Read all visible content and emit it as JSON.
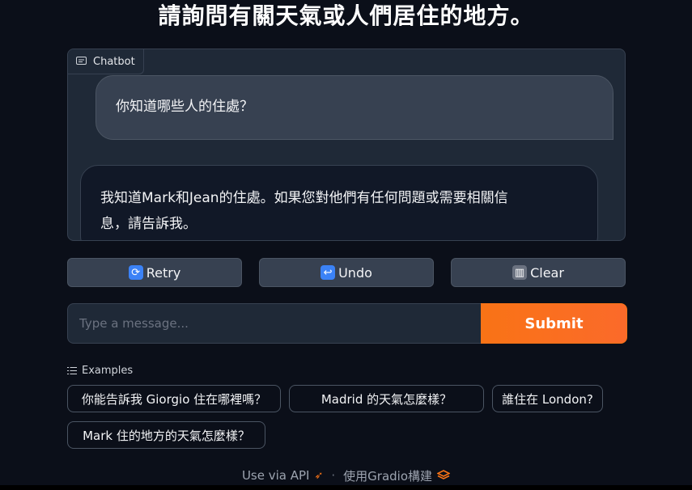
{
  "title": "請詢問有關天氣或人們居住的地方。",
  "chatbot": {
    "label": "Chatbot",
    "messages": [
      {
        "role": "user",
        "text": "你知道哪些人的住處？"
      },
      {
        "role": "bot",
        "line1": "我知道Mark和Jean的住處。如果您對他們有任何問題或需要相關信",
        "line2": "息，請告訴我。"
      }
    ]
  },
  "buttons": {
    "retry": "Retry",
    "undo": "Undo",
    "clear": "Clear"
  },
  "input": {
    "placeholder": "Type a message...",
    "value": ""
  },
  "submit_label": "Submit",
  "examples": {
    "label": "Examples",
    "items": [
      "你能告訴我 Giorgio 住在哪裡嗎？",
      "Madrid 的天氣怎麼樣？",
      "誰住在 London?",
      "Mark 住的地方的天氣怎麼樣？"
    ]
  },
  "footer": {
    "api": "Use via API",
    "separator": "·",
    "built_with": "使用Gradio構建"
  },
  "colors": {
    "background": "#0b0f19",
    "panel": "#1f2937",
    "accent": "#f97316"
  }
}
